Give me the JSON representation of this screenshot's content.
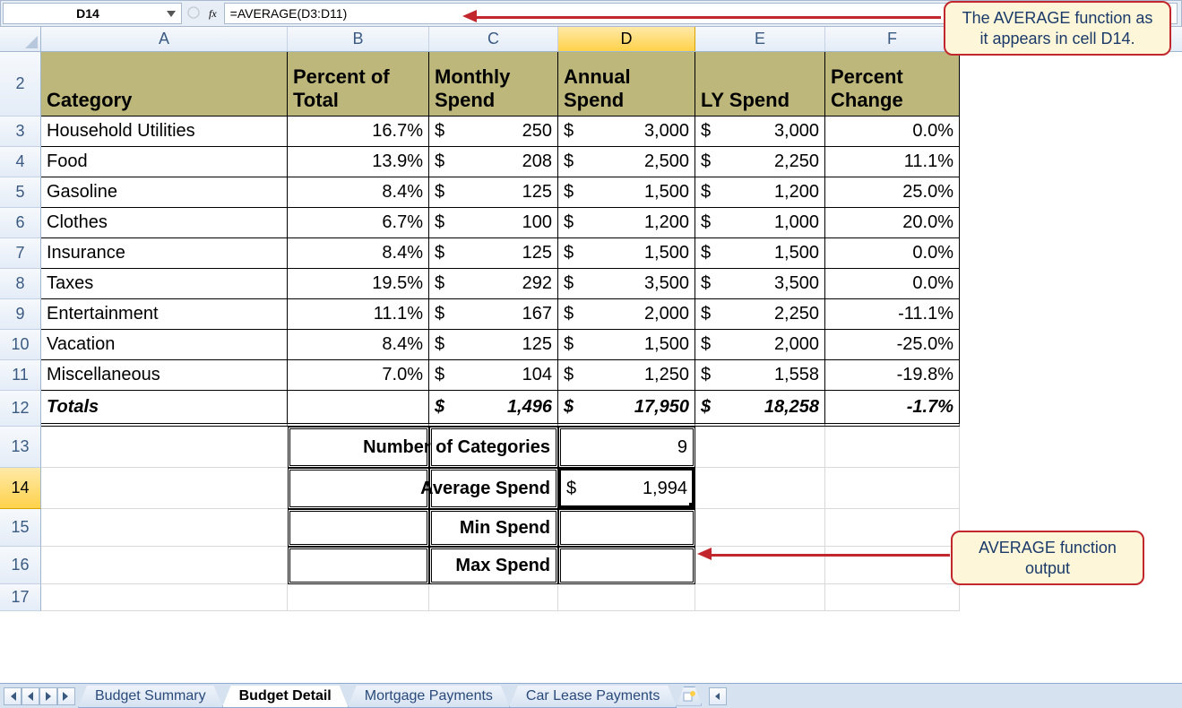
{
  "formula_bar": {
    "cell_ref": "D14",
    "fx_label": "fx",
    "formula": "=AVERAGE(D3:D11)"
  },
  "columns": [
    "A",
    "B",
    "C",
    "D",
    "E",
    "F"
  ],
  "selected_column": "D",
  "selected_row": "14",
  "headers": {
    "A": "Category",
    "B": "Percent of Total",
    "C": "Monthly Spend",
    "D": "Annual Spend",
    "E": "LY Spend",
    "F": "Percent Change"
  },
  "rows": [
    {
      "num": "3",
      "cat": "Household Utilities",
      "pct": "16.7%",
      "m": "250",
      "a": "3,000",
      "ly": "3,000",
      "pc": "0.0%"
    },
    {
      "num": "4",
      "cat": "Food",
      "pct": "13.9%",
      "m": "208",
      "a": "2,500",
      "ly": "2,250",
      "pc": "11.1%"
    },
    {
      "num": "5",
      "cat": "Gasoline",
      "pct": "8.4%",
      "m": "125",
      "a": "1,500",
      "ly": "1,200",
      "pc": "25.0%"
    },
    {
      "num": "6",
      "cat": "Clothes",
      "pct": "6.7%",
      "m": "100",
      "a": "1,200",
      "ly": "1,000",
      "pc": "20.0%"
    },
    {
      "num": "7",
      "cat": "Insurance",
      "pct": "8.4%",
      "m": "125",
      "a": "1,500",
      "ly": "1,500",
      "pc": "0.0%"
    },
    {
      "num": "8",
      "cat": "Taxes",
      "pct": "19.5%",
      "m": "292",
      "a": "3,500",
      "ly": "3,500",
      "pc": "0.0%"
    },
    {
      "num": "9",
      "cat": "Entertainment",
      "pct": "11.1%",
      "m": "167",
      "a": "2,000",
      "ly": "2,250",
      "pc": "-11.1%"
    },
    {
      "num": "10",
      "cat": "Vacation",
      "pct": "8.4%",
      "m": "125",
      "a": "1,500",
      "ly": "2,000",
      "pc": "-25.0%"
    },
    {
      "num": "11",
      "cat": "Miscellaneous",
      "pct": "7.0%",
      "m": "104",
      "a": "1,250",
      "ly": "1,558",
      "pc": "-19.8%"
    }
  ],
  "totals": {
    "num": "12",
    "label": "Totals",
    "m": "1,496",
    "a": "17,950",
    "ly": "18,258",
    "pc": "-1.7%"
  },
  "summary": {
    "r13": {
      "num": "13",
      "label": "Number of Categories",
      "val": "9"
    },
    "r14": {
      "num": "14",
      "label": "Average Spend",
      "val": "1,994"
    },
    "r15": {
      "num": "15",
      "label": "Min Spend",
      "val": ""
    },
    "r16": {
      "num": "16",
      "label": "Max Spend",
      "val": ""
    }
  },
  "blank_row": "17",
  "sheet_tabs": [
    "Budget Summary",
    "Budget Detail",
    "Mortgage Payments",
    "Car Lease Payments"
  ],
  "active_tab": 1,
  "callouts": {
    "top": "The AVERAGE function as it appears in cell D14.",
    "mid": "AVERAGE function output"
  },
  "currency_symbol": "$"
}
